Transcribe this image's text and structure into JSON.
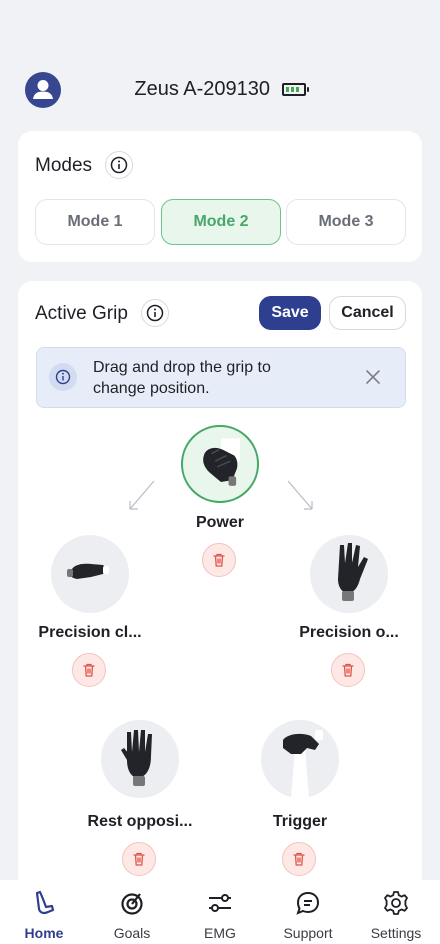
{
  "header": {
    "device_name": "Zeus A-209130",
    "battery_color": "#3fae4a"
  },
  "modes": {
    "title": "Modes",
    "items": [
      {
        "label": "Mode 1"
      },
      {
        "label": "Mode 2"
      },
      {
        "label": "Mode 3"
      }
    ],
    "active_index": 1
  },
  "active_grip": {
    "title": "Active Grip",
    "save_label": "Save",
    "cancel_label": "Cancel",
    "banner_text": "Drag and drop the grip to change position.",
    "grips": [
      {
        "label": "Power",
        "selected": true
      },
      {
        "label": "Precision cl..."
      },
      {
        "label": "Precision o..."
      },
      {
        "label": "Rest opposi..."
      },
      {
        "label": "Trigger"
      }
    ]
  },
  "nav": {
    "items": [
      {
        "label": "Home",
        "icon": "home-icon"
      },
      {
        "label": "Goals",
        "icon": "goals-icon"
      },
      {
        "label": "EMG",
        "icon": "emg-icon"
      },
      {
        "label": "Support",
        "icon": "support-icon"
      },
      {
        "label": "Settings",
        "icon": "settings-icon"
      }
    ],
    "active": "Home"
  },
  "colors": {
    "primary": "#2f3f8f",
    "accent_green": "#45a866",
    "danger": "#e0534a"
  }
}
